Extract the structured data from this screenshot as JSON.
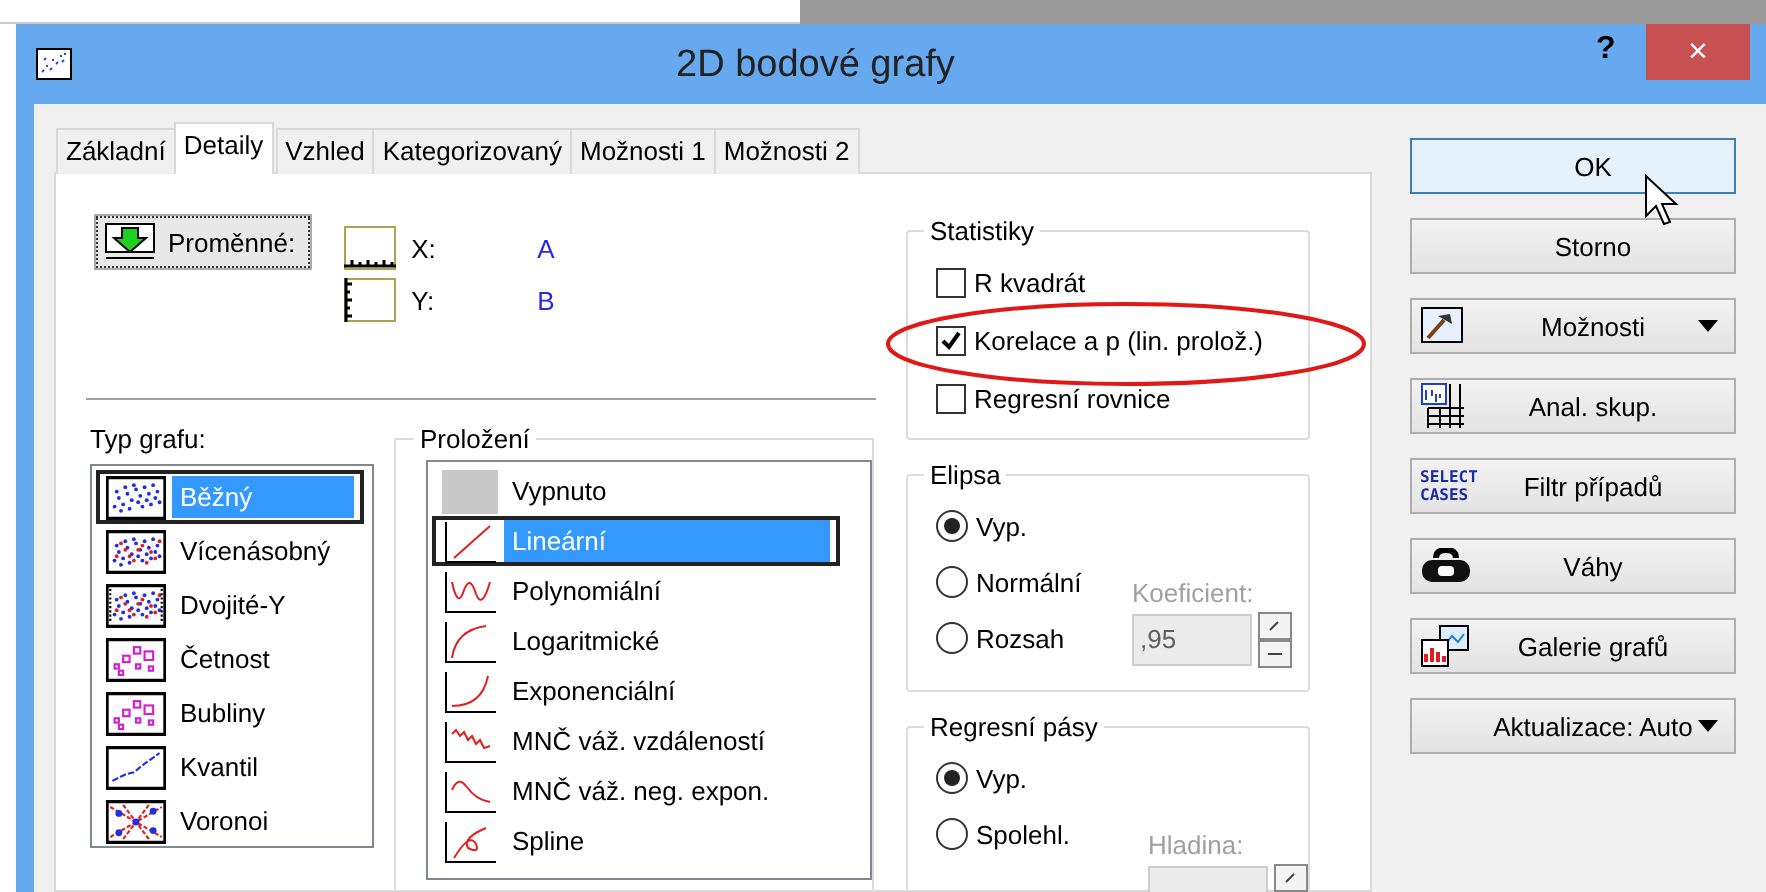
{
  "window": {
    "title": "2D bodové grafy",
    "help": "?",
    "close": "×"
  },
  "tabs": [
    {
      "label": "Základní",
      "selected": false
    },
    {
      "label": "Detaily",
      "selected": true
    },
    {
      "label": "Vzhled",
      "selected": false
    },
    {
      "label": "Kategorizovaný",
      "selected": false
    },
    {
      "label": "Možnosti 1",
      "selected": false
    },
    {
      "label": "Možnosti 2",
      "selected": false
    }
  ],
  "variables": {
    "button": "Proměnné:",
    "axes": [
      {
        "kind": "x",
        "label": "X:",
        "value": "A"
      },
      {
        "kind": "y",
        "label": "Y:",
        "value": "B"
      }
    ]
  },
  "graph_type": {
    "label": "Typ grafu:",
    "items": [
      {
        "kind": "regular",
        "label": "Běžný",
        "selected": true
      },
      {
        "kind": "multiple",
        "label": "Vícenásobný",
        "selected": false
      },
      {
        "kind": "double-y",
        "label": "Dvojité-Y",
        "selected": false
      },
      {
        "kind": "frequency",
        "label": "Četnost",
        "selected": false
      },
      {
        "kind": "bubble",
        "label": "Bubliny",
        "selected": false
      },
      {
        "kind": "quantile",
        "label": "Kvantil",
        "selected": false
      },
      {
        "kind": "voronoi",
        "label": "Voronoi",
        "selected": false
      }
    ]
  },
  "fit": {
    "title": "Proložení",
    "items": [
      {
        "kind": "off",
        "label": "Vypnuto",
        "selected": false
      },
      {
        "kind": "linear",
        "label": "Lineární",
        "selected": true
      },
      {
        "kind": "polynomial",
        "label": "Polynomiální",
        "selected": false
      },
      {
        "kind": "logarithmic",
        "label": "Logaritmické",
        "selected": false
      },
      {
        "kind": "exponential",
        "label": "Exponenciální",
        "selected": false
      },
      {
        "kind": "lowess-distance",
        "label": "MNČ váž. vzdáleností",
        "selected": false
      },
      {
        "kind": "lowess-negexp",
        "label": "MNČ váž. neg. expon.",
        "selected": false
      },
      {
        "kind": "spline",
        "label": "Spline",
        "selected": false
      }
    ]
  },
  "statistics": {
    "title": "Statistiky",
    "items": [
      {
        "label": "R kvadrát",
        "checked": false
      },
      {
        "label": "Korelace a p (lin. prolož.)",
        "checked": true
      },
      {
        "label": "Regresní rovnice",
        "checked": false
      }
    ]
  },
  "ellipse": {
    "title": "Elipsa",
    "options": [
      {
        "label": "Vyp.",
        "selected": true
      },
      {
        "label": "Normální",
        "selected": false
      },
      {
        "label": "Rozsah",
        "selected": false
      }
    ],
    "coefficient": {
      "label": "Koeficient:",
      "value": ",95",
      "disabled": true
    }
  },
  "regression_bands": {
    "title": "Regresní pásy",
    "options": [
      {
        "label": "Vyp.",
        "selected": true
      },
      {
        "label": "Spolehl.",
        "selected": false
      }
    ],
    "confidence": {
      "label": "Hladina:",
      "disabled": true
    }
  },
  "buttons": [
    {
      "kind": "default",
      "label": "OK",
      "dropdown": false
    },
    {
      "kind": "plain",
      "label": "Storno",
      "dropdown": false
    },
    {
      "kind": "options",
      "label": "Možnosti",
      "dropdown": true
    },
    {
      "kind": "group-analysis",
      "label": "Anal. skup.",
      "dropdown": false
    },
    {
      "kind": "case-filter",
      "label": "Filtr případů",
      "dropdown": false,
      "icon_text": [
        "SELECT",
        "CASES"
      ]
    },
    {
      "kind": "weights",
      "label": "Váhy",
      "dropdown": false
    },
    {
      "kind": "gallery",
      "label": "Galerie grafů",
      "dropdown": false
    },
    {
      "kind": "update",
      "label": "Aktualizace: Auto",
      "dropdown": true
    }
  ]
}
